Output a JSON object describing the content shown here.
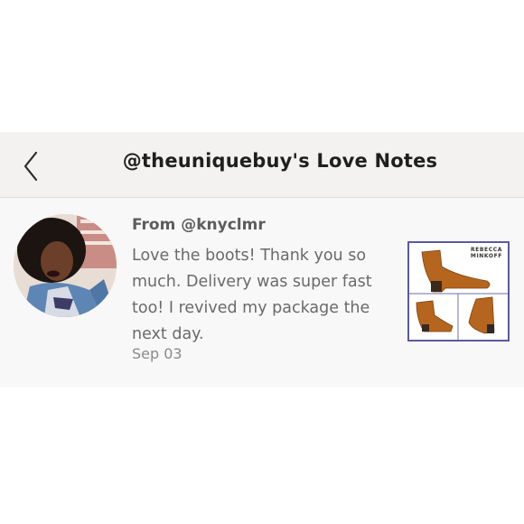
{
  "header": {
    "title": "@theuniquebuy's Love Notes",
    "back_icon": "chevron-left-icon"
  },
  "note": {
    "from": "From @knyclmr",
    "body": "Love the boots! Thank you so much. Delivery was super fast too! I revived my package the next day.",
    "date": "Sep 03",
    "product": {
      "brand_line1": "REBECCA",
      "brand_line2": "MINKOFF"
    }
  },
  "colors": {
    "header_background": "#f3f2f0",
    "card_background": "#f8f8f8",
    "product_border": "#5a5aa0",
    "boot_color": "#b5651d"
  }
}
